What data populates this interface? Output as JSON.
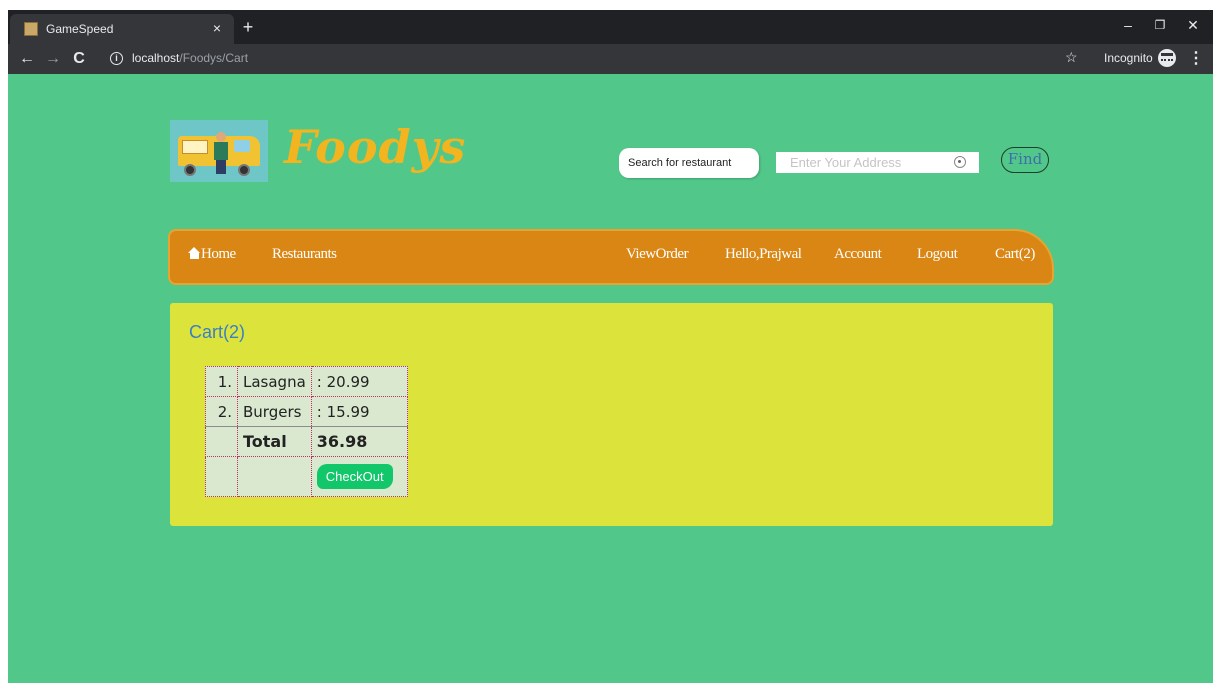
{
  "browser": {
    "tab_title": "GameSpeed",
    "tab_close": "×",
    "new_tab": "+",
    "url_host": "localhost",
    "url_path": "/Foodys/Cart",
    "incognito_label": "Incognito",
    "window_controls": {
      "minimize": "–",
      "restore": "❐",
      "close": "✕"
    },
    "icons": [
      "back-arrow-icon",
      "forward-arrow-icon",
      "reload-icon",
      "info-icon",
      "star-icon",
      "incognito-icon",
      "menu-icon"
    ]
  },
  "header": {
    "logo_text": "Foodys",
    "search_placeholder": "Search for restaurant",
    "address_placeholder": "Enter Your Address",
    "find_label": "Find"
  },
  "nav": {
    "home": "Home",
    "restaurants": "Restaurants",
    "view_order": "ViewOrder",
    "greeting": "Hello,Prajwal",
    "account": "Account",
    "logout": "Logout",
    "cart": "Cart(2)"
  },
  "cart": {
    "title": "Cart(2)",
    "items": [
      {
        "num": "1.",
        "name": "Lasagna",
        "price": ": 20.99"
      },
      {
        "num": "2.",
        "name": "Burgers",
        "price": ": 15.99"
      }
    ],
    "total_label": "Total",
    "total_value": "36.98",
    "checkout_label": "CheckOut"
  },
  "colors": {
    "page_bg": "#52c78a",
    "logo_yellow": "#f2b41f",
    "navbar_bg": "#d98614",
    "panel_bg": "#dce43c",
    "cart_title": "#3b7fc4",
    "checkout_bg": "#12c76a"
  }
}
